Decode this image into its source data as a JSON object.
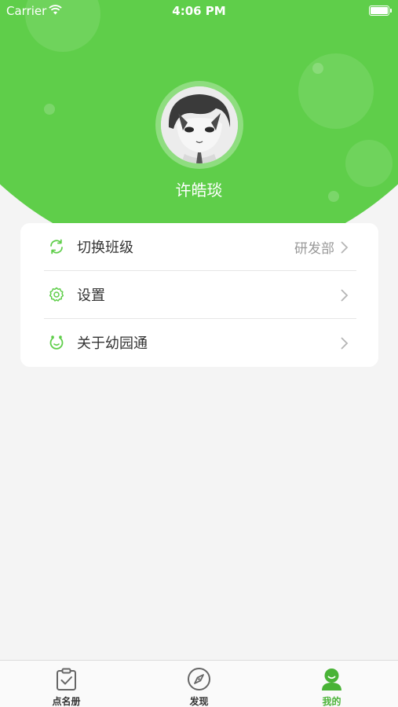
{
  "status_bar": {
    "carrier": "Carrier",
    "time": "4:06 PM"
  },
  "profile": {
    "name": "许皓琰"
  },
  "menu": [
    {
      "label": "切换班级",
      "value": "研发部",
      "icon": "refresh-icon"
    },
    {
      "label": "设置",
      "value": "",
      "icon": "gear-icon"
    },
    {
      "label": "关于幼园通",
      "value": "",
      "icon": "about-icon"
    }
  ],
  "tabs": [
    {
      "label": "点名册",
      "icon": "clipboard-check-icon",
      "active": false
    },
    {
      "label": "发现",
      "icon": "compass-icon",
      "active": false
    },
    {
      "label": "我的",
      "icon": "user-icon",
      "active": true
    }
  ],
  "colors": {
    "accent": "#5fce4a",
    "active_tab": "#49b336"
  }
}
